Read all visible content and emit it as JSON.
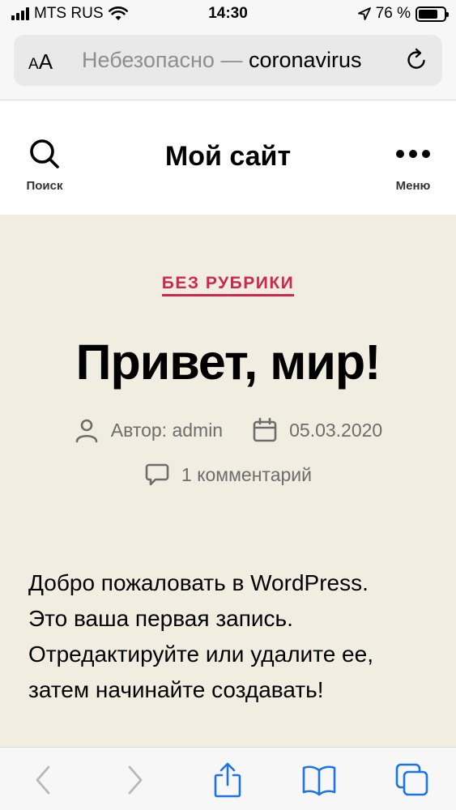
{
  "status_bar": {
    "carrier": "MTS RUS",
    "time": "14:30",
    "battery_percent": "76 %",
    "battery_level": 0.76
  },
  "browser": {
    "text_size_label": "AA",
    "url_insecure_label": "Небезопасно — ",
    "url_domain": "coronavirus"
  },
  "site": {
    "title": "Мой сайт",
    "search_label": "Поиск",
    "menu_label": "Меню"
  },
  "post": {
    "category": "БЕЗ РУБРИКИ",
    "title": "Привет, мир!",
    "author": "Автор: admin",
    "date": "05.03.2020",
    "comments": "1 комментарий",
    "body": [
      "Добро пожаловать в WordPress.",
      "Это ваша первая запись.",
      "Отредактируйте или удалите ее,",
      "затем начинайте создавать!"
    ]
  },
  "colors": {
    "accent": "#cd2653",
    "content_bg": "#f1ede0",
    "browser_blue": "#1a73e8"
  }
}
